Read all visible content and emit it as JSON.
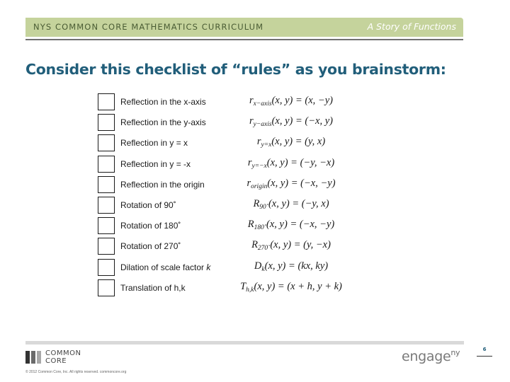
{
  "header": {
    "left_title": "NYS COMMON CORE MATHEMATICS CURRICULUM",
    "right_title": "A Story of Functions"
  },
  "slide_title": "Consider this checklist of “rules” as you brainstorm:",
  "checklist": [
    {
      "label": "Reflection in the x-axis",
      "fn": "r",
      "sub": "x−axis",
      "rhs": "(x, −y)",
      "checked": false
    },
    {
      "label": "Reflection in the y-axis",
      "fn": "r",
      "sub": "y−axis",
      "rhs": "(−x, y)",
      "checked": false
    },
    {
      "label": "Reflection in y = x",
      "fn": "r",
      "sub": "y=x",
      "rhs": "(y, x)",
      "checked": false
    },
    {
      "label": "Reflection in y = -x",
      "fn": "r",
      "sub": "y=−x",
      "rhs": "(−y, −x)",
      "checked": false
    },
    {
      "label": "Reflection in the origin",
      "fn": "r",
      "sub": "origin",
      "rhs": "(−x, −y)",
      "checked": false
    },
    {
      "label": "Rotation of 90˚",
      "fn": "R",
      "sub": "90˚",
      "rhs": "(−y, x)",
      "checked": false
    },
    {
      "label": "Rotation of 180˚",
      "fn": "R",
      "sub": "180˚",
      "rhs": "(−x, −y)",
      "checked": false
    },
    {
      "label": "Rotation of 270˚",
      "fn": "R",
      "sub": "270˚",
      "rhs": "(y, −x)",
      "checked": false
    },
    {
      "label": "Dilation of scale factor ",
      "label_italic": "k",
      "fn": "D",
      "sub": "k",
      "rhs": "(kx, ky)",
      "checked": false
    },
    {
      "label": "Translation of h,k",
      "fn": "T",
      "sub": "h,k",
      "rhs": "(x + h, y + k)",
      "checked": false
    }
  ],
  "formula_args": "(x, y) = ",
  "footer": {
    "logo_line1": "COMMON",
    "logo_line2": "CORE",
    "copyright": "© 2012 Common Core, Inc. All rights reserved. commoncore.org",
    "engage_text": "engage",
    "engage_sup": "ny",
    "page_number": "6"
  },
  "colors": {
    "header_bar": "#c5d39c",
    "header_text": "#4a5c34",
    "title": "#215e7a",
    "footer_bar": "#d9d9d9"
  }
}
